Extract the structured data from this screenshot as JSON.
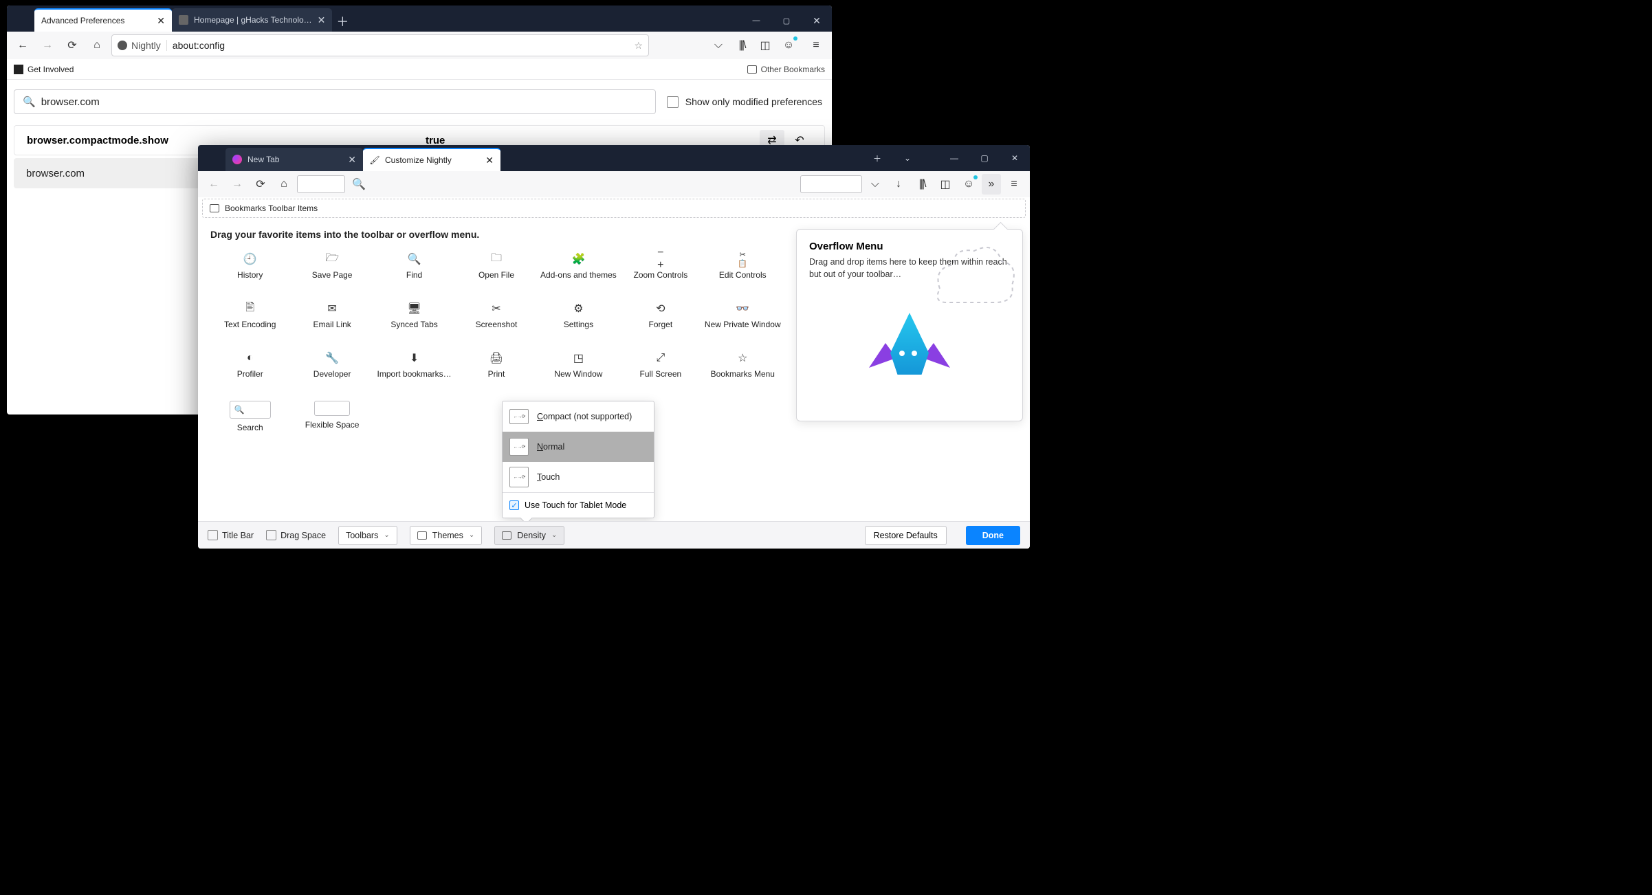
{
  "win1": {
    "tabs": [
      {
        "title": "Advanced Preferences",
        "active": true
      },
      {
        "title": "Homepage | gHacks Technolo…",
        "active": false
      }
    ],
    "nav": {
      "identity_label": "Nightly",
      "url": "about:config"
    },
    "bookmarks_bar": {
      "left_item": "Get Involved",
      "right_item": "Other Bookmarks"
    },
    "search_value": "browser.com",
    "show_modified_label": "Show only modified preferences",
    "pref": {
      "name": "browser.compactmode.show",
      "value": "true"
    },
    "next_row": "browser.com"
  },
  "win2": {
    "tabs": [
      {
        "title": "New Tab",
        "active": false
      },
      {
        "title": "Customize Nightly",
        "active": true
      }
    ],
    "bm_strip": "Bookmarks Toolbar Items",
    "palette_heading": "Drag your favorite items into the toolbar or overflow menu.",
    "palette_items": [
      "History",
      "Save Page",
      "Find",
      "Open File",
      "Add-ons and themes",
      "Zoom Controls",
      "Edit Controls",
      "Text Encoding",
      "Email Link",
      "Synced Tabs",
      "Screenshot",
      "Settings",
      "Forget",
      "New Private Window",
      "Profiler",
      "Developer",
      "Import bookmarks…",
      "Print",
      "New Window",
      "Full Screen",
      "Bookmarks Menu",
      "Search",
      "Flexible Space"
    ],
    "overflow": {
      "title": "Overflow Menu",
      "desc": "Drag and drop items here to keep them within reach but out of your toolbar…"
    },
    "footer": {
      "titlebar": "Title Bar",
      "dragspace": "Drag Space",
      "toolbars": "Toolbars",
      "themes": "Themes",
      "density": "Density",
      "restore": "Restore Defaults",
      "done": "Done"
    },
    "density_menu": {
      "compact": "Compact (not supported)",
      "normal": "Normal",
      "touch": "Touch",
      "tablet": "Use Touch for Tablet Mode"
    }
  }
}
